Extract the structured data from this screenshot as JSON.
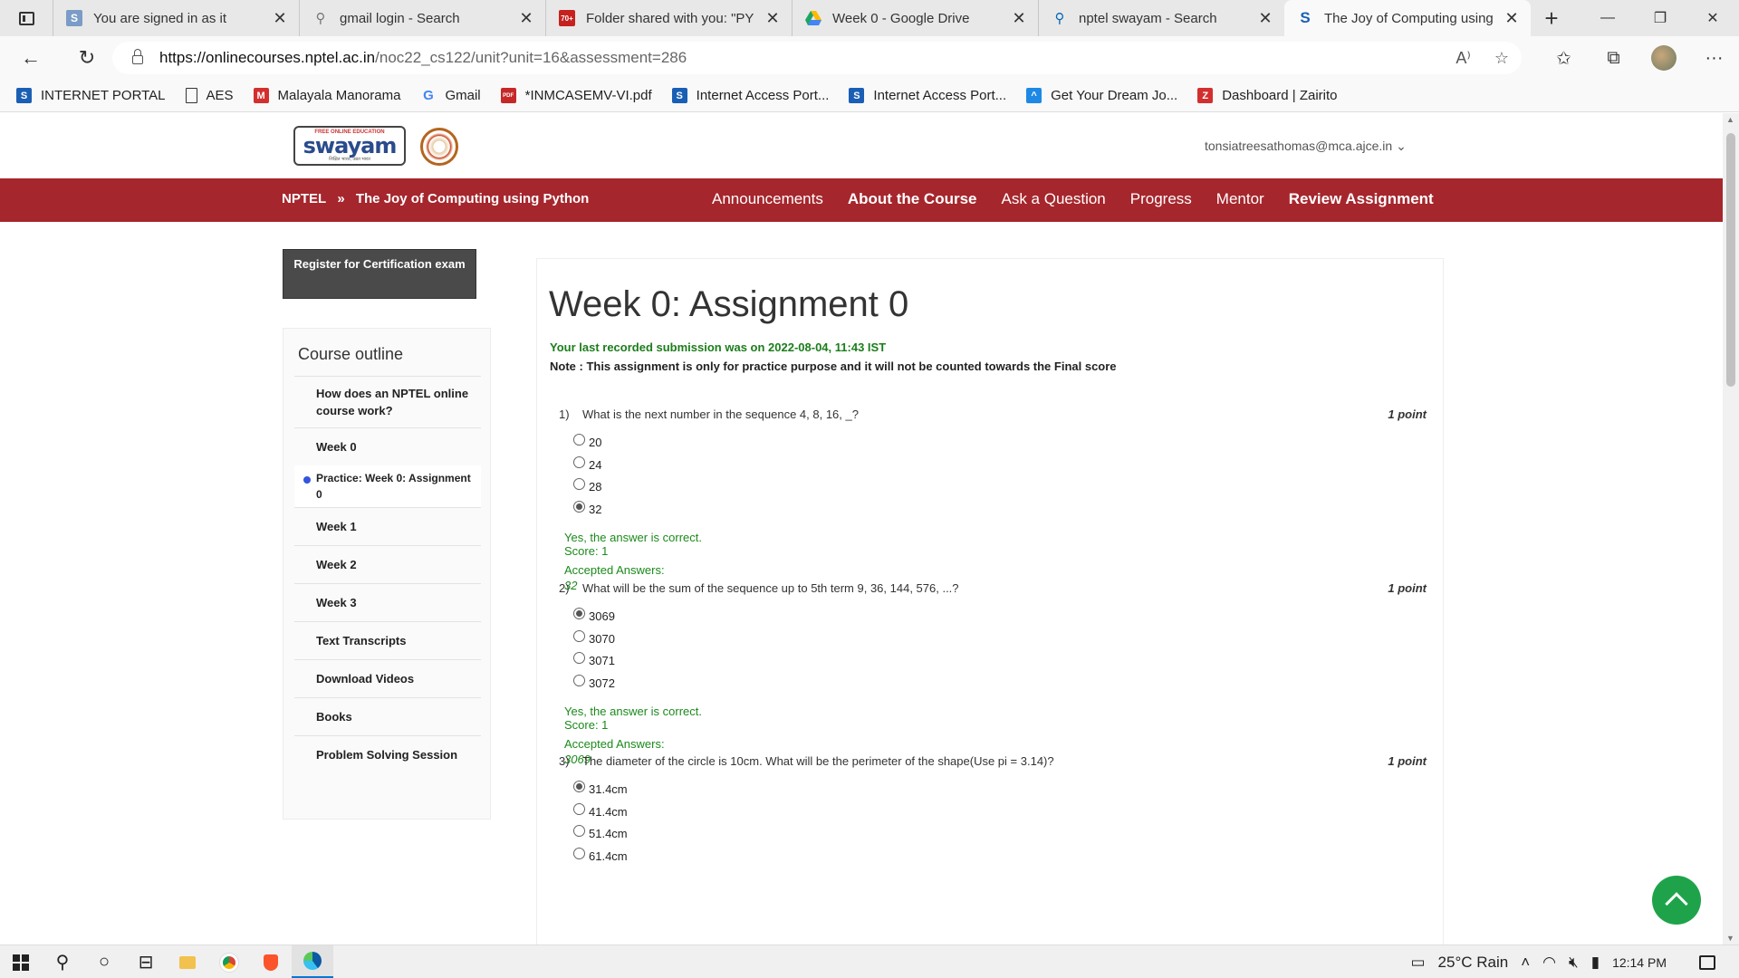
{
  "browser": {
    "tabs": [
      {
        "title": "You are signed in as it",
        "favicon": "S",
        "color": "#7a9cc6"
      },
      {
        "title": "gmail login - Search",
        "favicon": "search",
        "color": "#777777"
      },
      {
        "title": "Folder shared with you: \"PY",
        "favicon": "70+",
        "color": "#c5221f"
      },
      {
        "title": "Week 0 - Google Drive",
        "favicon": "drive",
        "color": "#1fa463"
      },
      {
        "title": "nptel swayam - Search",
        "favicon": "search",
        "color": "#0067b8"
      },
      {
        "title": "The Joy of Computing using",
        "favicon": "S",
        "color": "#1a5fb4"
      }
    ],
    "url_host": "https://onlinecourses.nptel.ac.in",
    "url_path": "/noc22_cs122/unit?unit=16&assessment=286",
    "bookmarks": [
      {
        "label": "INTERNET PORTAL",
        "icon": "S",
        "color": "#1a5fb4"
      },
      {
        "label": "AES",
        "icon": "doc",
        "color": "#ffffff"
      },
      {
        "label": "Malayala Manorama",
        "icon": "M",
        "color": "#d32f2f"
      },
      {
        "label": "Gmail",
        "icon": "G",
        "color": "#4285f4"
      },
      {
        "label": "*INMCASEMV-VI.pdf",
        "icon": "PDF",
        "color": "#c62828"
      },
      {
        "label": "Internet Access Port...",
        "icon": "S",
        "color": "#1a5fb4"
      },
      {
        "label": "Internet Access Port...",
        "icon": "S",
        "color": "#1a5fb4"
      },
      {
        "label": "Get Your Dream Jo...",
        "icon": "^",
        "color": "#1e88e5"
      },
      {
        "label": "Dashboard | Zairito",
        "icon": "Z",
        "color": "#d32f2f"
      }
    ]
  },
  "site": {
    "logo_small": "FREE ONLINE EDUCATION",
    "logo_text": "swayam",
    "logo_tag": "शिक्षित भारत, उन्नत भारत",
    "user_email": "tonsiatreesathomas@mca.ajce.in",
    "breadcrumb_root": "NPTEL",
    "breadcrumb_sep": "»",
    "breadcrumb_course": "The Joy of Computing using Python",
    "nav": [
      "Announcements",
      "About the Course",
      "Ask a Question",
      "Progress",
      "Mentor",
      "Review Assignment"
    ]
  },
  "sidebar": {
    "cert_button": "Register for Certification exam",
    "outline_title": "Course outline",
    "items": [
      "How does an NPTEL online course work?",
      "Week 0",
      "Practice: Week 0: Assignment 0",
      "Week 1",
      "Week 2",
      "Week 3",
      "Text Transcripts",
      "Download Videos",
      "Books",
      "Problem Solving Session"
    ]
  },
  "assignment": {
    "title": "Week 0: Assignment 0",
    "submission": "Your last recorded submission was on 2022-08-04, 11:43 IST",
    "note": "Note : This assignment is only for practice purpose and it will not be counted towards the Final score",
    "questions": [
      {
        "num": "1)",
        "text": "What is the next number in the sequence 4, 8, 16, _?",
        "points": "1 point",
        "options": [
          "20",
          "24",
          "28",
          "32"
        ],
        "selected": 3,
        "feedback": "Yes, the answer is correct.",
        "score": "Score: 1",
        "accepted_label": "Accepted Answers:",
        "accepted": "32"
      },
      {
        "num": "2)",
        "text": "What will be the sum of the sequence up to 5th term 9, 36, 144, 576, ...?",
        "points": "1 point",
        "options": [
          "3069",
          "3070",
          "3071",
          "3072"
        ],
        "selected": 0,
        "feedback": "Yes, the answer is correct.",
        "score": "Score: 1",
        "accepted_label": "Accepted Answers:",
        "accepted": "3069"
      },
      {
        "num": "3)",
        "text": "The diameter of the circle is 10cm. What will be the perimeter of the shape(Use pi = 3.14)?",
        "points": "1 point",
        "options": [
          "31.4cm",
          "41.4cm",
          "51.4cm",
          "61.4cm"
        ],
        "selected": 0
      }
    ]
  },
  "taskbar": {
    "weather": "25°C  Rain",
    "time": "12:14 PM"
  }
}
